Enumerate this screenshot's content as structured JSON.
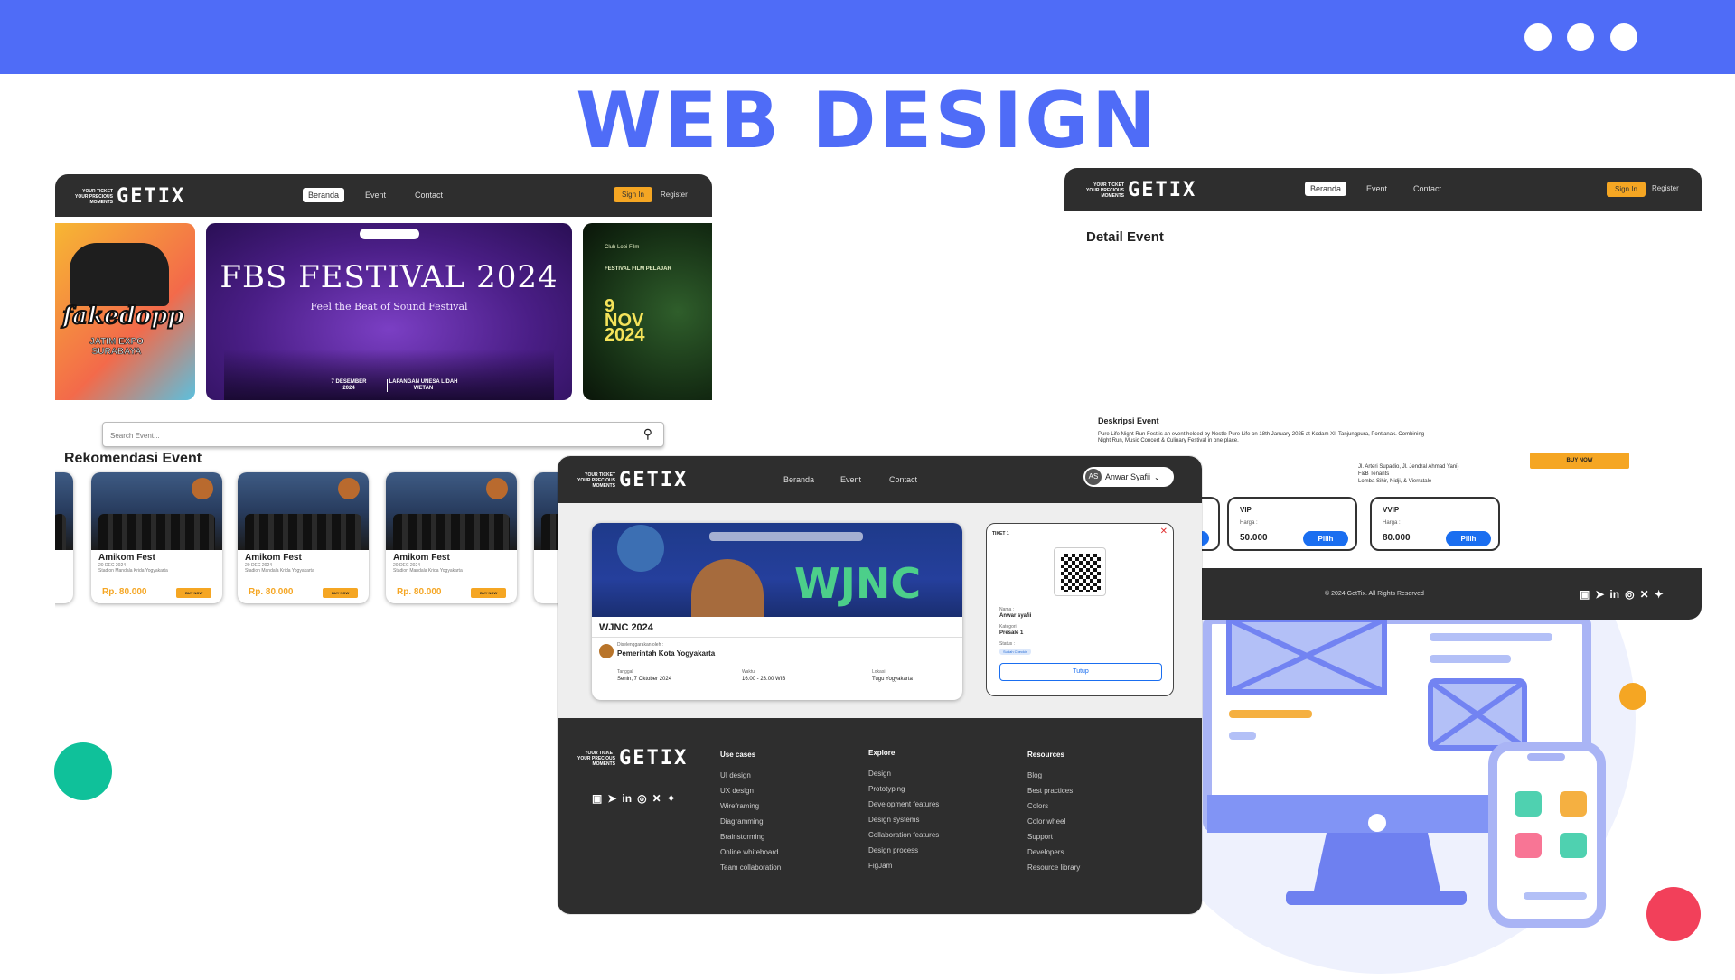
{
  "header": {
    "title": "WEB DESIGN"
  },
  "colors": {
    "brand": "#4f6cf7",
    "accent": "#f5a623",
    "dark": "#2e2e2e",
    "blue_button": "#1a6ef0"
  },
  "nav": {
    "logo_tag": "YOUR TICKET YOUR PRECIOUS MOMENTS",
    "logo_name": "GETIX",
    "links": [
      "Beranda",
      "Event",
      "Contact"
    ],
    "sign_in": "Sign In",
    "register": "Register"
  },
  "home": {
    "banner_left": {
      "name": "fakedopp",
      "sub": "JATIM EXPO SURABAYA"
    },
    "banner_main": {
      "title": "FBS FESTIVAL 2024",
      "subtitle": "Feel the Beat of Sound Festival",
      "date": "7 DESEMBER 2024",
      "venue": "LAPANGAN UNESA LIDAH WETAN"
    },
    "banner_right": {
      "org": "Club Lobi Film",
      "name": "FESTIVAL FILM PELAJAR",
      "date_line1": "9",
      "date_line2": "NOV",
      "date_line3": "2024"
    },
    "search_placeholder": "Search Event...",
    "section_title": "Rekomendasi Event",
    "cards": [
      {
        "title": "Amikom Fest",
        "date": "20 DEC 2024",
        "venue": "Stadion Mandala Krida Yogyakarta",
        "price": "Rp. 80.000",
        "buy": "BUY NOW"
      },
      {
        "title": "Amikom Fest",
        "date": "20 DEC 2024",
        "venue": "Stadion Mandala Krida Yogyakarta",
        "price": "Rp. 80.000",
        "buy": "BUY NOW"
      },
      {
        "title": "Amikom Fest",
        "date": "20 DEC 2024",
        "venue": "Stadion Mandala Krida Yogyakarta",
        "price": "Rp. 80.000",
        "buy": "BUY NOW"
      }
    ]
  },
  "detail": {
    "heading": "Detail Event",
    "desc_label": "Deskripsi Event",
    "desc_text": "Pure Life Night Run Fest is an event helded by Nestle Pure Life on 18th January 2025 at Kodam XII Tanjungpura, Pontianak. Combining Night Run, Music Concert & Culinary Festival in one place.",
    "bullets": [
      "Jl. Arteri Supadio, Jl. Jendral Ahmad Yani)",
      "F&B Tenants",
      "Lomba Sihir, Nidji, & Vierratale"
    ],
    "buy_now": "BUY NOW",
    "tickets": [
      {
        "label": "VIP",
        "harga_label": "Harga :",
        "price": "50.000",
        "button": "Pilih"
      },
      {
        "label": "VVIP",
        "harga_label": "Harga :",
        "price": "80.000",
        "button": "Pilih"
      }
    ],
    "footer_copy": "© 2024 GetTix. All Rights Reserved"
  },
  "ticket_page": {
    "user_initials": "AS",
    "user_name": "Anwar Syafii",
    "event_title": "WJNC 2024",
    "banner_text": "WJNC",
    "organizer_label": "Diselenggarakan oleh :",
    "organizer": "Pemerintah Kota Yogyakarta",
    "tanggal_label": "Tanggal",
    "tanggal": "Senin, 7 Oktober 2024",
    "waktu_label": "Waktu",
    "waktu": "16.00 - 23.00 WIB",
    "lokasi_label": "Lokasi",
    "lokasi": "Tugu Yogyakarta",
    "ticket_label": "TIKET 1",
    "nama_label": "Nama :",
    "nama": "Anwar syafii",
    "kategori_label": "Kategori :",
    "kategori": "Presale 1",
    "status_label": "Status :",
    "status": "Sudah Checkin",
    "close_button": "Tutup"
  },
  "footer": {
    "columns": [
      {
        "title": "Use cases",
        "items": [
          "UI design",
          "UX design",
          "Wireframing",
          "Diagramming",
          "Brainstorming",
          "Online whiteboard",
          "Team collaboration"
        ]
      },
      {
        "title": "Explore",
        "items": [
          "Design",
          "Prototyping",
          "Development features",
          "Design systems",
          "Collaboration features",
          "Design process",
          "FigJam"
        ]
      },
      {
        "title": "Resources",
        "items": [
          "Blog",
          "Best practices",
          "Colors",
          "Color wheel",
          "Support",
          "Developers",
          "Resource library"
        ]
      }
    ],
    "socials": [
      "linkedin-icon",
      "telegram-icon",
      "in-icon",
      "instagram-icon",
      "x-icon",
      "twitter-icon"
    ]
  }
}
